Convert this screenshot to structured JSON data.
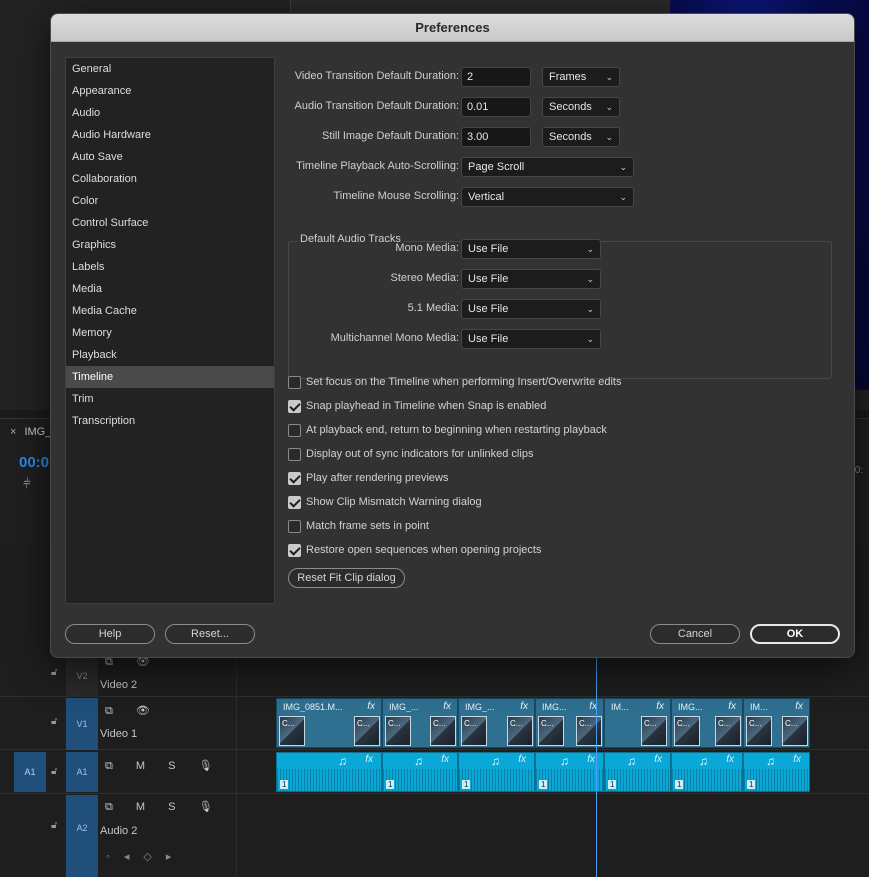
{
  "dialog": {
    "title": "Preferences",
    "sidebar": [
      "General",
      "Appearance",
      "Audio",
      "Audio Hardware",
      "Auto Save",
      "Collaboration",
      "Color",
      "Control Surface",
      "Graphics",
      "Labels",
      "Media",
      "Media Cache",
      "Memory",
      "Playback",
      "Timeline",
      "Trim",
      "Transcription"
    ],
    "active_item": "Timeline",
    "settings": {
      "video_transition": {
        "label": "Video Transition Default Duration:",
        "value": "2",
        "unit": "Frames"
      },
      "audio_transition": {
        "label": "Audio Transition Default Duration:",
        "value": "0.01",
        "unit": "Seconds"
      },
      "still_image": {
        "label": "Still Image Default Duration:",
        "value": "3.00",
        "unit": "Seconds"
      },
      "auto_scroll": {
        "label": "Timeline Playback Auto-Scrolling:",
        "value": "Page Scroll"
      },
      "mouse_scroll": {
        "label": "Timeline Mouse Scrolling:",
        "value": "Vertical"
      }
    },
    "audio_tracks": {
      "title": "Default Audio Tracks",
      "mono": {
        "label": "Mono Media:",
        "value": "Use File"
      },
      "stereo": {
        "label": "Stereo Media:",
        "value": "Use File"
      },
      "five_one": {
        "label": "5.1 Media:",
        "value": "Use File"
      },
      "multi": {
        "label": "Multichannel Mono Media:",
        "value": "Use File"
      }
    },
    "checkboxes": [
      {
        "label": "Set focus on the Timeline when performing Insert/Overwrite edits",
        "checked": false
      },
      {
        "label": "Snap playhead in Timeline when Snap is enabled",
        "checked": true
      },
      {
        "label": "At playback end, return to beginning when restarting playback",
        "checked": false
      },
      {
        "label": "Display out of sync indicators for unlinked clips",
        "checked": false
      },
      {
        "label": "Play after rendering previews",
        "checked": true
      },
      {
        "label": "Show Clip Mismatch Warning dialog",
        "checked": true
      },
      {
        "label": "Match frame sets in point",
        "checked": false
      },
      {
        "label": "Restore open sequences when opening projects",
        "checked": true
      }
    ],
    "reset_fit_clip": "Reset Fit Clip dialog",
    "buttons": {
      "help": "Help",
      "reset": "Reset...",
      "cancel": "Cancel",
      "ok": "OK"
    }
  },
  "timeline": {
    "sequence_tab": "IMG_",
    "timecode": "00:0",
    "edge_time": ":0:",
    "tracks": {
      "v2": {
        "id": "V2",
        "name": "Video 2"
      },
      "v1": {
        "id": "V1",
        "name": "Video 1"
      },
      "a1": {
        "id": "A1",
        "source": "A1"
      },
      "a2": {
        "id": "A2",
        "name": "Audio 2"
      }
    },
    "icons": {
      "m": "M",
      "s": "S"
    },
    "clips": [
      "IMG_0851.M...",
      "IMG_...",
      "IMG_...",
      "IMG...",
      "IM...",
      "IMG...",
      "IM..."
    ],
    "thumb_label": "C...",
    "fx": "fx",
    "note": "♫",
    "channel": "1"
  },
  "colors": {
    "accent": "#2d8ceb",
    "video_clip": "#2f6f8f",
    "audio_clip": "#0aa8d6"
  }
}
